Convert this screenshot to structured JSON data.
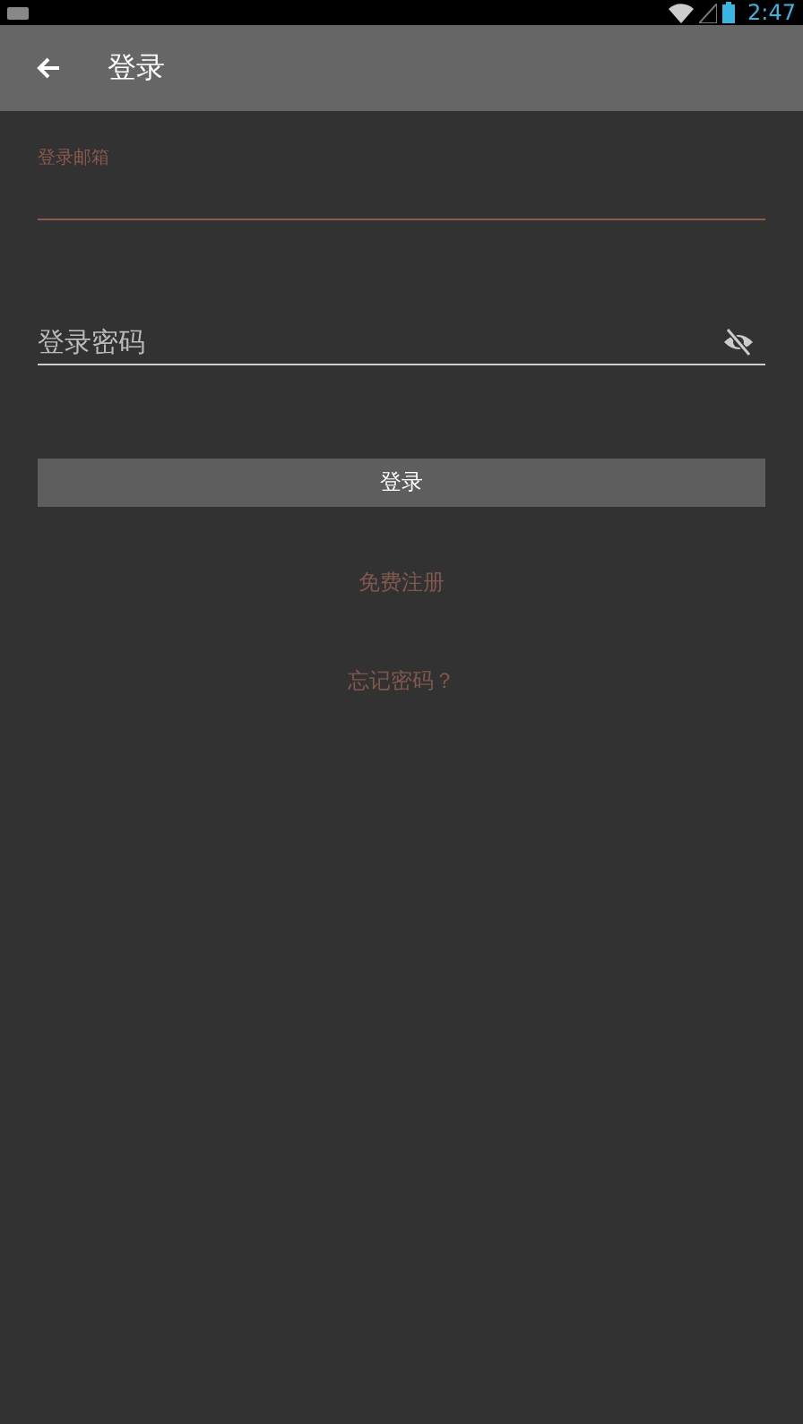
{
  "status_bar": {
    "time": "2:47"
  },
  "app_bar": {
    "title": "登录"
  },
  "fields": [
    {
      "kind": "text",
      "label": "登录邮箱",
      "focused": true
    },
    {
      "kind": "password",
      "placeholder": "登录密码",
      "focused": false
    }
  ],
  "login_button": "登录",
  "links": [
    "免费注册",
    "忘记密码？"
  ]
}
